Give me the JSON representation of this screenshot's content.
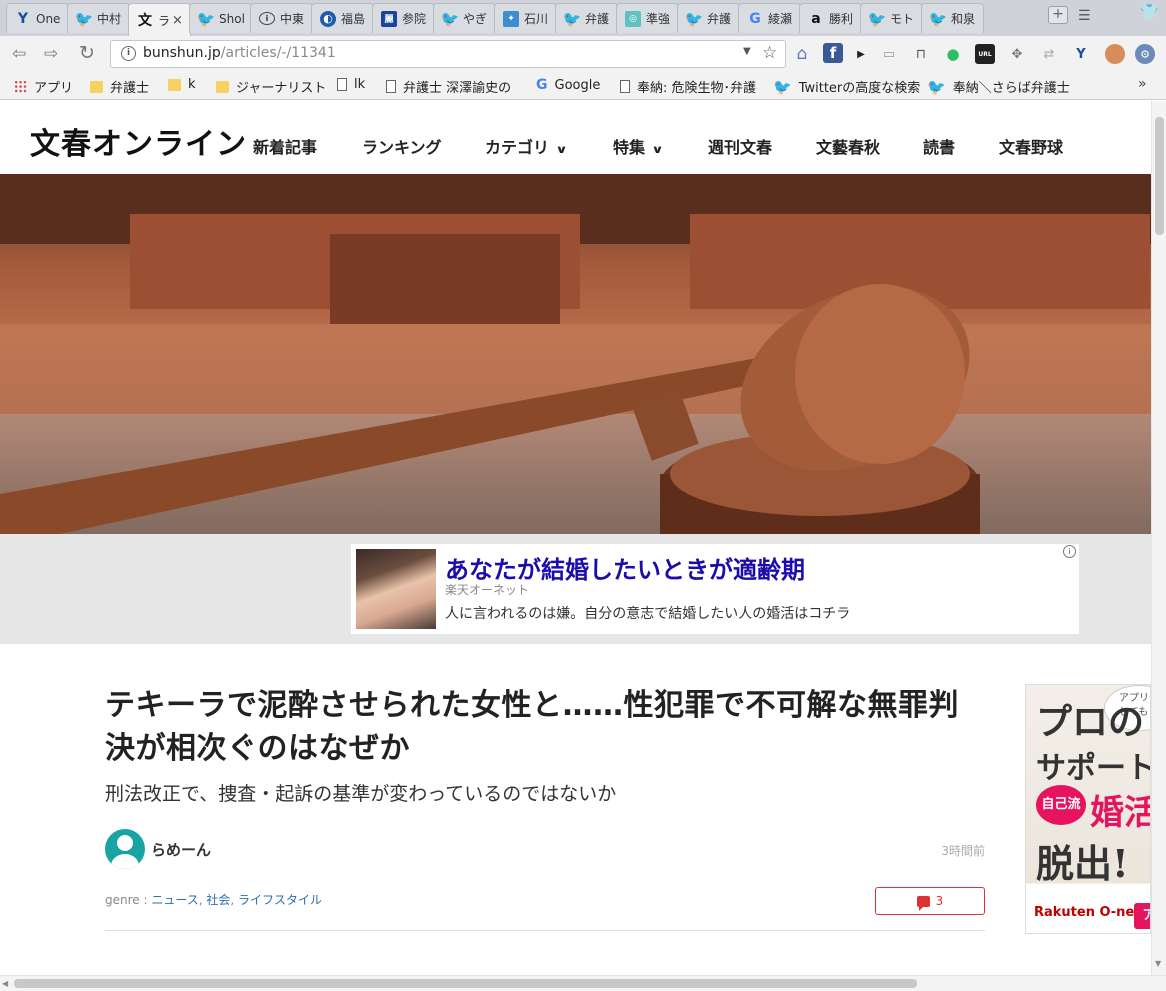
{
  "browser": {
    "tabs": [
      {
        "favicon": "Y",
        "favicon_type": "y",
        "title": "One"
      },
      {
        "favicon": "🐦",
        "favicon_type": "tw",
        "title": "中村"
      },
      {
        "favicon": "文",
        "favicon_type": "bun",
        "title": "ラ",
        "active": true,
        "close": "×"
      },
      {
        "favicon": "🐦",
        "favicon_type": "tw",
        "title": "Shol"
      },
      {
        "favicon": "i",
        "favicon_type": "circ",
        "title": "中東"
      },
      {
        "favicon": "◐",
        "favicon_type": "jp",
        "title": "福島"
      },
      {
        "favicon": "麗",
        "favicon_type": "nv",
        "title": "参院"
      },
      {
        "favicon": "🐦",
        "favicon_type": "tw",
        "title": "やぎ"
      },
      {
        "favicon": "✦",
        "favicon_type": "blue",
        "title": "石川"
      },
      {
        "favicon": "🐦",
        "favicon_type": "tw",
        "title": "弁護"
      },
      {
        "favicon": "◎",
        "favicon_type": "teal",
        "title": "準強"
      },
      {
        "favicon": "🐦",
        "favicon_type": "tw",
        "title": "弁護"
      },
      {
        "favicon": "G",
        "favicon_type": "g",
        "title": "綾瀬"
      },
      {
        "favicon": "a",
        "favicon_type": "amz",
        "title": "勝利"
      },
      {
        "favicon": "🐦",
        "favicon_type": "tw",
        "title": "モト"
      },
      {
        "favicon": "🐦",
        "favicon_type": "tw",
        "title": "和泉"
      }
    ],
    "newtab_label": "+",
    "url_domain": "bunshun.jp",
    "url_path": "/articles/-/11341",
    "bookmarks": [
      {
        "icon": "apps",
        "label": "アプリ"
      },
      {
        "icon": "folder",
        "label": "弁護士"
      },
      {
        "icon": "folder",
        "label": "k"
      },
      {
        "icon": "folder",
        "label": "ジャーナリスト"
      },
      {
        "icon": "page",
        "label": "lk"
      },
      {
        "icon": "page",
        "label": "弁護士 深澤諭史の"
      },
      {
        "icon": "google",
        "label": "Google"
      },
      {
        "icon": "page",
        "label": "奉納: 危険生物･弁護"
      },
      {
        "icon": "twitter",
        "label": "Twitterの高度な検索"
      },
      {
        "icon": "twitter",
        "label": "奉納＼さらば弁護士"
      }
    ],
    "bookmarks_more": "»"
  },
  "site": {
    "logo": "文春オンライン",
    "nav": [
      {
        "label": "新着記事",
        "dropdown": false
      },
      {
        "label": "ランキング",
        "dropdown": false
      },
      {
        "label": "カテゴリ",
        "dropdown": true
      },
      {
        "label": "特集",
        "dropdown": true
      },
      {
        "label": "週刊文春",
        "dropdown": false
      },
      {
        "label": "文藝春秋",
        "dropdown": false
      },
      {
        "label": "読書",
        "dropdown": false
      },
      {
        "label": "文春野球",
        "dropdown": false
      }
    ],
    "nav_chevron": "⌄"
  },
  "ad": {
    "headline": "あなたが結婚したいときが適齢期",
    "source": "楽天オーネット",
    "text": "人に言われるのは嫌。自分の意志で結婚したい人の婚活はコチラ",
    "adchoices": "i"
  },
  "article": {
    "title": "テキーラで泥酔させられた女性と……性犯罪で不可解な無罪判決が相次ぐのはなぜか",
    "subtitle": "刑法改正で、捜査・起訴の基準が変わっているのではないか",
    "author": "らめーん",
    "timestamp": "3時間前",
    "genre_label": "genre : ",
    "genres": [
      "ニュース",
      "社会",
      "ライフスタイル"
    ],
    "comment_count": "3"
  },
  "side_ad": {
    "line1": "プロの",
    "line2": "サポート",
    "badge": "自己流",
    "line3": "婚活",
    "line4": "脱出!",
    "bubble": "アプリや 試しても",
    "brand": "Rakuten O-net",
    "cta": "ア"
  }
}
